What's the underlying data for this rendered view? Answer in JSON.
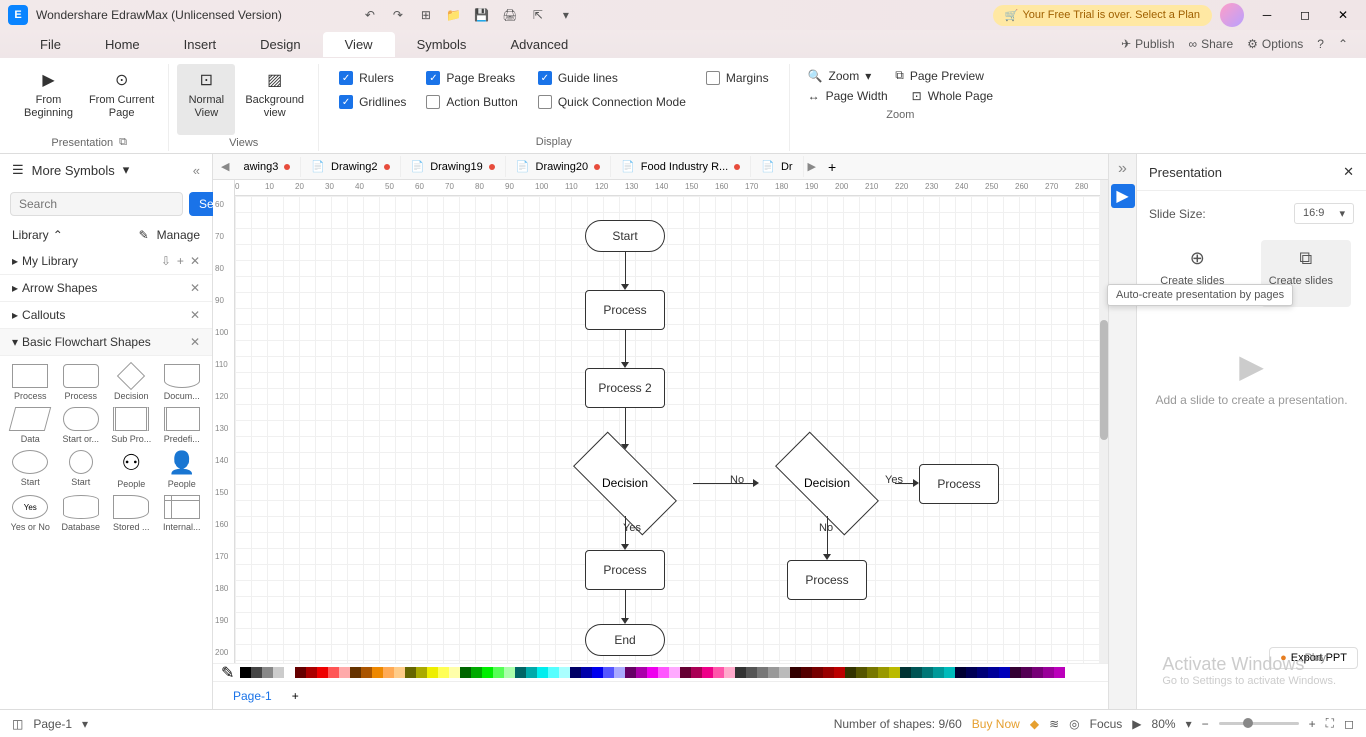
{
  "title": "Wondershare EdrawMax (Unlicensed Version)",
  "trial_banner": "Your Free Trial is over. Select a Plan",
  "menubar": {
    "items": [
      "File",
      "Home",
      "Insert",
      "Design",
      "View",
      "Symbols",
      "Advanced"
    ],
    "active": 4,
    "right": {
      "publish": "Publish",
      "share": "Share",
      "options": "Options"
    }
  },
  "ribbon": {
    "presentation": {
      "label": "Presentation",
      "from_beginning": "From\nBeginning",
      "from_current": "From Current\nPage"
    },
    "views": {
      "label": "Views",
      "normal": "Normal\nView",
      "background": "Background\nview"
    },
    "display": {
      "label": "Display",
      "rulers": "Rulers",
      "page_breaks": "Page Breaks",
      "guide_lines": "Guide lines",
      "margins": "Margins",
      "gridlines": "Gridlines",
      "action_button": "Action Button",
      "quick_conn": "Quick Connection Mode"
    },
    "zoom": {
      "label": "Zoom",
      "zoom": "Zoom",
      "page_preview": "Page Preview",
      "page_width": "Page Width",
      "whole_page": "Whole Page"
    }
  },
  "left": {
    "more_symbols": "More Symbols",
    "search_placeholder": "Search",
    "search_btn": "Search",
    "library": "Library",
    "manage": "Manage",
    "sections": [
      "My Library",
      "Arrow Shapes",
      "Callouts",
      "Basic Flowchart Shapes"
    ],
    "shapes": [
      {
        "label": "Process"
      },
      {
        "label": "Process"
      },
      {
        "label": "Decision"
      },
      {
        "label": "Docum..."
      },
      {
        "label": "Data"
      },
      {
        "label": "Start or..."
      },
      {
        "label": "Sub Pro..."
      },
      {
        "label": "Predefi..."
      },
      {
        "label": "Start"
      },
      {
        "label": "Start"
      },
      {
        "label": "People"
      },
      {
        "label": "People"
      },
      {
        "label": "Yes or No"
      },
      {
        "label": "Database"
      },
      {
        "label": "Stored ..."
      },
      {
        "label": "Internal..."
      }
    ]
  },
  "tabs": [
    "awing3",
    "Drawing2",
    "Drawing19",
    "Drawing20",
    "Food Industry R...",
    "Dr"
  ],
  "flowchart": {
    "start": "Start",
    "process": "Process",
    "process2": "Process 2",
    "decision": "Decision",
    "decision2": "Decision",
    "process3": "Process",
    "process4": "Process",
    "process5": "Process",
    "end": "End",
    "yes": "Yes",
    "no": "No"
  },
  "right": {
    "title": "Presentation",
    "slide_size_label": "Slide Size:",
    "slide_size": "16:9",
    "create_manual": "Create slides ...",
    "create_auto": "Create slides ...",
    "tooltip": "Auto-create presentation by pages",
    "empty": "Add a slide to create a presentation.",
    "export": "Export PPT",
    "play": "Play"
  },
  "status": {
    "page": "Page-1",
    "page_tab": "Page-1",
    "shapes": "Number of shapes: 9/60",
    "buy": "Buy Now",
    "focus": "Focus",
    "zoom": "80%"
  },
  "watermark": {
    "title": "Activate Windows",
    "sub": "Go to Settings to activate Windows."
  },
  "h_ticks": [
    0,
    10,
    20,
    30,
    40,
    50,
    60,
    70,
    80,
    90,
    100,
    110,
    120,
    130,
    140,
    150,
    160,
    170,
    180,
    190,
    200,
    210,
    220,
    230,
    240,
    250,
    260,
    270,
    280
  ],
  "v_ticks": [
    60,
    70,
    80,
    90,
    100,
    110,
    120,
    130,
    140,
    150,
    160,
    170,
    180,
    190,
    200
  ]
}
